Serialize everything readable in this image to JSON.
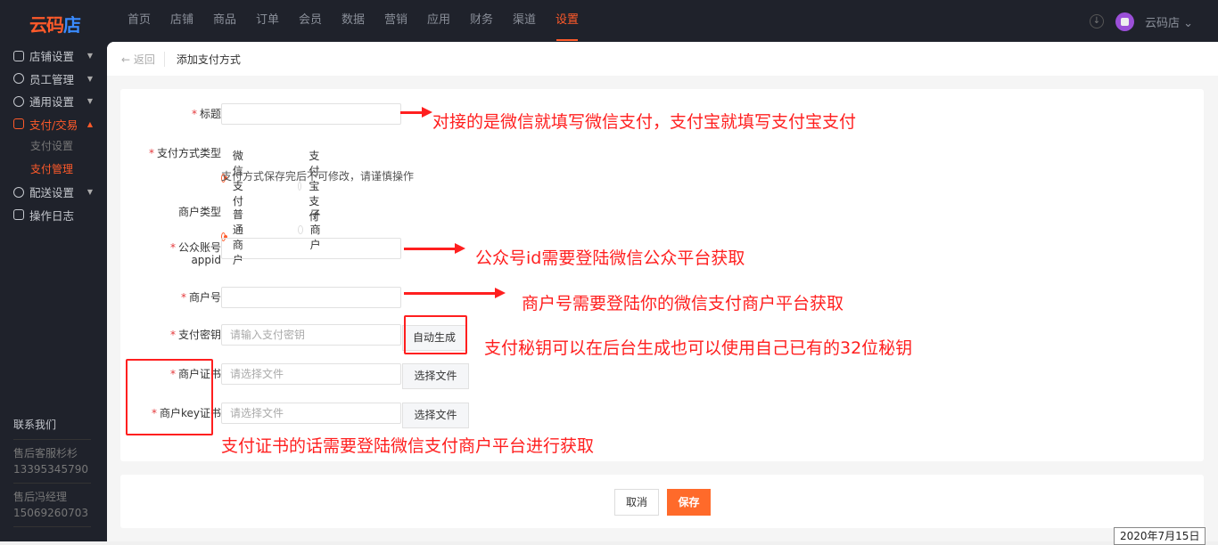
{
  "header": {
    "logo": "云码店",
    "nav": [
      "首页",
      "店铺",
      "商品",
      "订单",
      "会员",
      "数据",
      "营销",
      "应用",
      "财务",
      "渠道",
      "设置"
    ],
    "active_nav": "设置",
    "user": "云码店"
  },
  "sidebar": {
    "items": [
      {
        "label": "店铺设置"
      },
      {
        "label": "员工管理"
      },
      {
        "label": "通用设置"
      },
      {
        "label": "支付/交易",
        "open": true
      },
      {
        "label": "配送设置"
      },
      {
        "label": "操作日志"
      }
    ],
    "sub_items": [
      {
        "label": "支付设置"
      },
      {
        "label": "支付管理",
        "active": true
      }
    ],
    "contact": {
      "title": "联系我们",
      "people": [
        {
          "name": "售后客服杉杉",
          "phone": "13395345790"
        },
        {
          "name": "售后冯经理",
          "phone": "15069260703"
        }
      ]
    }
  },
  "breadcrumb": {
    "back": "返回",
    "current": "添加支付方式"
  },
  "form": {
    "title_label": "标题",
    "type_label": "支付方式类型",
    "type_options": [
      "微信支付",
      "支付宝支付"
    ],
    "type_selected": "微信支付",
    "type_hint": "支付方式保存完后不可修改，请谨慎操作",
    "merchant_type_label": "商户类型",
    "merchant_type_options": [
      "普通商户",
      "子商户"
    ],
    "merchant_type_selected": "普通商户",
    "appid_label": "公众账号",
    "appid_label2": "appid",
    "mchid_label": "商户号",
    "key_label": "支付密钥",
    "key_placeholder": "请输入支付密钥",
    "key_button": "自动生成",
    "cert_label": "商户证书",
    "cert_placeholder": "请选择文件",
    "cert_button": "选择文件",
    "keycert_label": "商户key证书",
    "keycert_placeholder": "请选择文件",
    "keycert_button": "选择文件"
  },
  "annotations": {
    "title": "对接的是微信就填写微信支付，支付宝就填写支付宝支付",
    "appid": "公众号id需要登陆微信公众平台获取",
    "mchid": "商户号需要登陆你的微信支付商户平台获取",
    "key": "支付秘钥可以在后台生成也可以使用自己已有的32位秘钥",
    "cert": "支付证书的话需要登陆微信支付商户平台进行获取"
  },
  "footer": {
    "cancel": "取消",
    "save": "保存"
  },
  "taskbar_date": "2020年7月15日",
  "colors": {
    "accent": "#ff5a2a",
    "annotation": "#ff1f1f",
    "dark_bg": "#1f222b"
  }
}
